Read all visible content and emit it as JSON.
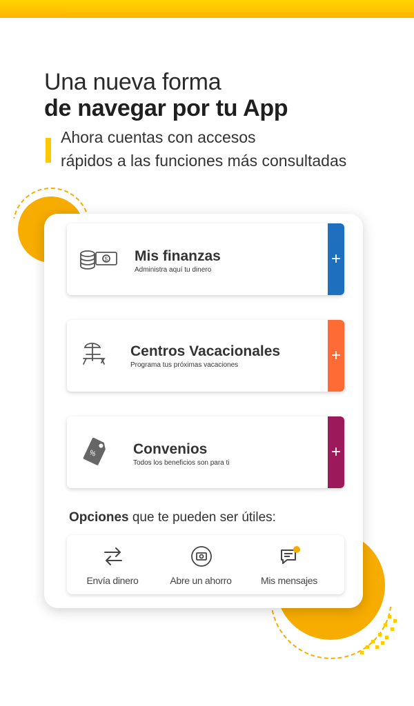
{
  "header": {
    "line1": "Una nueva forma",
    "line2": "de navegar por tu App",
    "sub1": "Ahora cuentas con accesos",
    "sub2": "rápidos a las funciones más consultadas"
  },
  "cards": [
    {
      "title": "Mis finanzas",
      "subtitle": "Administra aquí tu dinero",
      "accent": "#1f6fbf",
      "icon": "money-stack-icon",
      "plus": "+"
    },
    {
      "title": "Centros Vacacionales",
      "subtitle": "Programa tus próximas vacaciones",
      "accent": "#ff6b35",
      "icon": "beach-umbrella-icon",
      "plus": "+"
    },
    {
      "title": "Convenios",
      "subtitle": "Todos los beneficios son para ti",
      "accent": "#9c1a5a",
      "icon": "discount-tag-icon",
      "plus": "+"
    }
  ],
  "options": {
    "label_bold": "Opciones",
    "label_rest": " que te pueden ser útiles:",
    "items": [
      {
        "label": "Envía dinero",
        "icon": "transfer-arrows-icon"
      },
      {
        "label": "Abre un ahorro",
        "icon": "savings-icon"
      },
      {
        "label": "Mis mensajes",
        "icon": "messages-icon"
      }
    ]
  },
  "colors": {
    "brand_yellow": "#ffc800",
    "accent_orange": "#f7ac00"
  }
}
